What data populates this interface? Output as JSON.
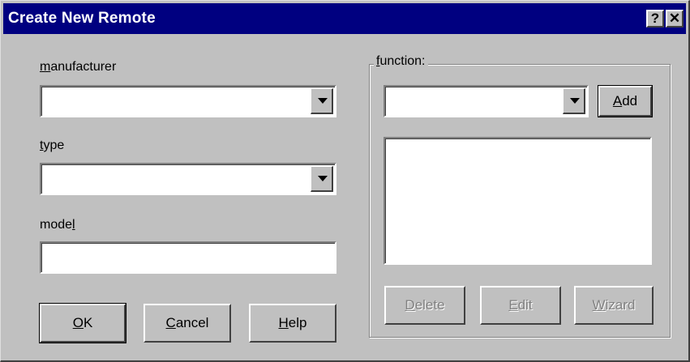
{
  "window": {
    "title": "Create New Remote",
    "help_button": "?",
    "close_button": "✕"
  },
  "form": {
    "manufacturer": {
      "label_hotkey": "m",
      "label_rest": "anufacturer",
      "value": ""
    },
    "type": {
      "label_hotkey": "t",
      "label_rest": "ype",
      "value": ""
    },
    "model": {
      "label_pre": "mode",
      "label_hotkey": "l",
      "value": ""
    }
  },
  "function_group": {
    "label_hotkey": "f",
    "label_rest": "unction:",
    "selected_value": "",
    "list_items": []
  },
  "buttons": {
    "ok": {
      "hotkey": "O",
      "rest": "K"
    },
    "cancel": {
      "hotkey": "C",
      "rest": "ancel"
    },
    "help": {
      "hotkey": "H",
      "rest": "elp"
    },
    "add": {
      "hotkey": "A",
      "rest": "dd"
    },
    "delete": {
      "hotkey": "D",
      "rest": "elete",
      "enabled": false
    },
    "edit": {
      "hotkey": "E",
      "rest": "dit",
      "enabled": false
    },
    "wizard": {
      "hotkey": "W",
      "rest": "izard",
      "enabled": false
    }
  },
  "colors": {
    "titlebar": "#000080",
    "face": "#c0c0c0",
    "disabled_text": "#808080"
  }
}
